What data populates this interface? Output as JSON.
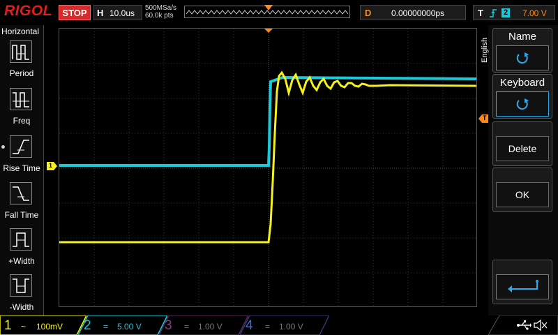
{
  "header": {
    "brand": "RIGOL",
    "run_state": "STOP",
    "timebase_letter": "H",
    "timebase_value": "10.0us",
    "sample_rate": "500MSa/s",
    "memory_depth": "60.0k pts",
    "delay_letter": "D",
    "delay_value": "0.00000000ps",
    "trigger_letter": "T",
    "trigger_source": "2",
    "trigger_level": "7.00 V"
  },
  "left_menu": {
    "title": "Horizontal",
    "items": [
      {
        "label": "Period",
        "icon": "period-icon"
      },
      {
        "label": "Freq",
        "icon": "frequency-icon"
      },
      {
        "label": "Rise Time",
        "icon": "rise-time-icon"
      },
      {
        "label": "Fall Time",
        "icon": "fall-time-icon"
      },
      {
        "label": "+Width",
        "icon": "positive-width-icon"
      },
      {
        "label": "-Width",
        "icon": "negative-width-icon"
      }
    ]
  },
  "right_menu": {
    "language": "English",
    "name_label": "Name",
    "keyboard_label": "Keyboard",
    "delete_label": "Delete",
    "ok_label": "OK"
  },
  "channels": [
    {
      "number": "1",
      "coupling": "~",
      "scale": "100mV",
      "color": "#f5f21b",
      "active": true
    },
    {
      "number": "2",
      "coupling": "=",
      "scale": "5.00 V",
      "color": "#1cc9d8",
      "active": true
    },
    {
      "number": "3",
      "coupling": "=",
      "scale": "1.00 V",
      "color": "#c03bc0",
      "active": false
    },
    {
      "number": "4",
      "coupling": "=",
      "scale": "1.00 V",
      "color": "#3a6ef0",
      "active": false
    }
  ],
  "markers": {
    "ch1_marker": "1",
    "trigger_marker": "T"
  },
  "colors": {
    "ch1": "#f5f21b",
    "ch2": "#1cc9d8",
    "trigger": "#ff8a1c",
    "stop": "#d82a2a",
    "brand": "#e21d1d"
  }
}
